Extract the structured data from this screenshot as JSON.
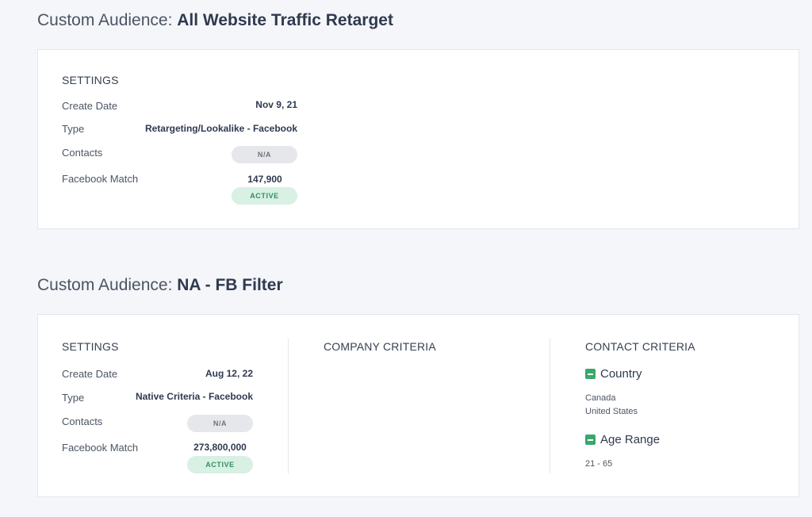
{
  "audiences": [
    {
      "title_prefix": "Custom Audience: ",
      "title_name": "All Website Traffic Retarget",
      "settings": {
        "heading": "SETTINGS",
        "create_date_label": "Create Date",
        "create_date_value": "Nov 9, 21",
        "type_label": "Type",
        "type_value": "Retargeting/Lookalike - Facebook",
        "contacts_label": "Contacts",
        "contacts_badge": "N/A",
        "fb_match_label": "Facebook Match",
        "fb_match_value": "147,900",
        "status_badge": "ACTIVE"
      }
    },
    {
      "title_prefix": "Custom Audience: ",
      "title_name": "NA - FB Filter",
      "settings": {
        "heading": "SETTINGS",
        "create_date_label": "Create Date",
        "create_date_value": "Aug 12, 22",
        "type_label": "Type",
        "type_value": "Native Criteria - Facebook",
        "contacts_label": "Contacts",
        "contacts_badge": "N/A",
        "fb_match_label": "Facebook Match",
        "fb_match_value": "273,800,000",
        "status_badge": "ACTIVE"
      },
      "company_criteria": {
        "heading": "COMPANY CRITERIA"
      },
      "contact_criteria": {
        "heading": "CONTACT CRITERIA",
        "groups": [
          {
            "label": "Country",
            "values": [
              "Canada",
              "United States"
            ]
          },
          {
            "label": "Age Range",
            "values": [
              "21 - 65"
            ]
          }
        ]
      }
    }
  ],
  "colors": {
    "accent_green": "#3aa76d",
    "active_badge_bg": "#d9f0e4",
    "na_badge_bg": "#e6e7ea",
    "page_bg": "#f5f6fa"
  },
  "icons": {
    "criteria_toggle": "minus-square-icon"
  }
}
